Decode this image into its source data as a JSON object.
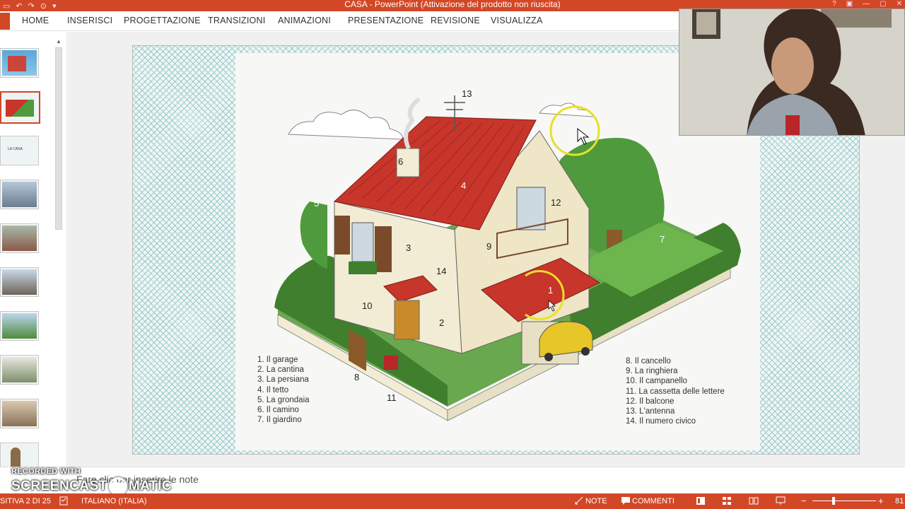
{
  "window": {
    "title": "CASA -  PowerPoint (Attivazione del prodotto non riuscita)"
  },
  "ribbon": {
    "tabs": [
      "HOME",
      "INSERISCI",
      "PROGETTAZIONE",
      "TRANSIZIONI",
      "ANIMAZIONI",
      "PRESENTAZIONE",
      "REVISIONE",
      "VISUALIZZA"
    ]
  },
  "slide": {
    "number_labels": [
      "1",
      "2",
      "3",
      "4",
      "5",
      "6",
      "7",
      "8",
      "9",
      "10",
      "11",
      "12",
      "13",
      "14"
    ],
    "legend_left": [
      "1. Il garage",
      "2. La cantina",
      "3. La persiana",
      "4. Il tetto",
      "5. La grondaia",
      "6. Il camino",
      "7. Il giardino"
    ],
    "legend_right": [
      "8. Il cancello",
      "9. La ringhiera",
      "10. Il campanello",
      "11. La cassetta delle lettere",
      "12. Il balcone",
      "13. L'antenna",
      "14. Il numero civico"
    ],
    "thumb3_text": "LA CASA"
  },
  "notes": {
    "placeholder": "Fare clic per inserire le note"
  },
  "watermark": {
    "line1": "RECORDED WITH",
    "line2a": "SCREENCAST",
    "line2b": "MATIC"
  },
  "status": {
    "slide_counter": "SITIVA 2 DI 25",
    "language": "ITALIANO (ITALIA)",
    "notes": "NOTE",
    "comments": "COMMENTI",
    "zoom": "81"
  },
  "colors": {
    "accent": "#d24726",
    "roof": "#c8352a",
    "tree": "#4f9a3c",
    "wall": "#f3ecd4"
  }
}
